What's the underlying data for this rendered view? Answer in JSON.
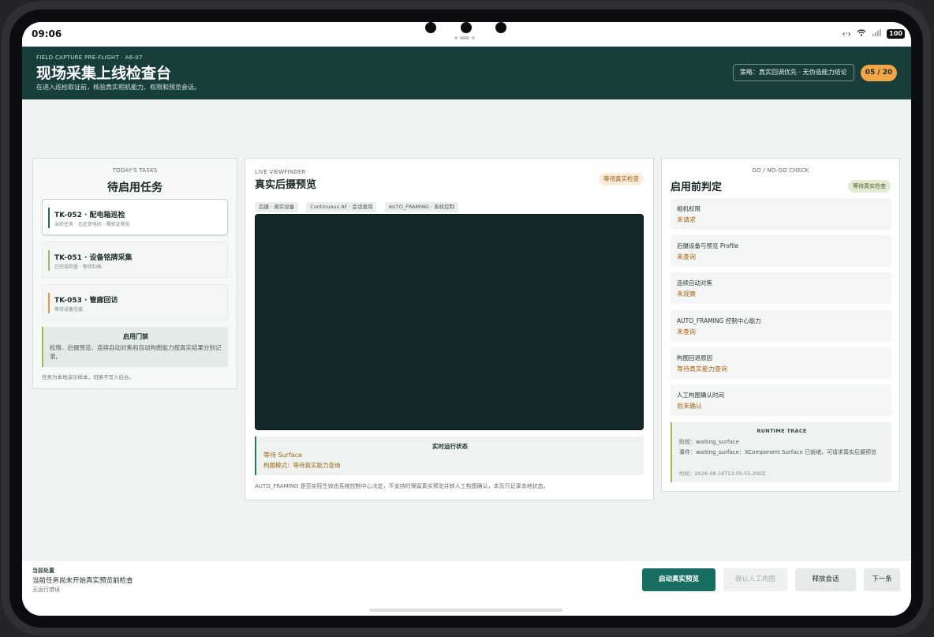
{
  "status_bar": {
    "time": "09:06",
    "battery": "100"
  },
  "header": {
    "eyebrow": "FIELD CAPTURE PRE-FLIGHT · A6-07",
    "title": "现场采集上线检查台",
    "subtitle": "在进入巡检取证前，核验真实相机能力、权限和预览会话。",
    "strategy": "策略：真实回调优先 · 无伪造能力结论",
    "counter": "05 / 20"
  },
  "tasks_panel": {
    "eyebrow": "TODAY'S TASKS",
    "title": "待启用任务",
    "tasks": [
      {
        "title": "TK-052 · 配电箱巡检",
        "subtitle": "当前任务 · 北区变电间 · 需验证预览",
        "accent": "#1e6f63"
      },
      {
        "title": "TK-051 · 设备铭牌采集",
        "subtitle": "已完成检查 · 等待归档",
        "accent": "#9bbb55"
      },
      {
        "title": "TK-053 · 管廊回访",
        "subtitle": "等待设备交接",
        "accent": "#e79b3f"
      }
    ],
    "gate": {
      "title": "启用门禁",
      "text": "权限、后摄预览、连续自动对焦和自动构图能力按真实结果分别记录。"
    },
    "note": "任务为本地演示样本，切换不写入后台。"
  },
  "viewfinder_panel": {
    "eyebrow": "LIVE VIEWFINDER",
    "title": "真实后摄预览",
    "status_pill": "等待真实检查",
    "tags": [
      "后摄 · 真实设备",
      "Continuous AF · 会话查询",
      "AUTO_FRAMING · 系统控制"
    ],
    "runtime": {
      "title": "实时运行状态",
      "status": "等待 Surface",
      "mode_label": "构图模式：",
      "mode_value": "等待真实能力查询"
    },
    "footnote": "AUTO_FRAMING 是否实际生效由系统控制中心决定，不支持时保留真实预览并转人工构图确认，本页只记录本地状态。"
  },
  "check_panel": {
    "eyebrow": "GO / NO-GO CHECK",
    "title": "启用前判定",
    "status_pill": "等待真实检查",
    "checks": [
      {
        "label": "相机权限",
        "value": "未请求"
      },
      {
        "label": "后摄设备与预览 Profile",
        "value": "未查询"
      },
      {
        "label": "连续自动对焦",
        "value": "未观察"
      },
      {
        "label": "AUTO_FRAMING 控制中心能力",
        "value": "未查询"
      },
      {
        "label": "构图回退原因",
        "value": "等待真实能力查询"
      },
      {
        "label": "人工构图确认时间",
        "value": "尚未确认"
      }
    ],
    "trace": {
      "title": "RUNTIME TRACE",
      "stage": "阶段：waiting_surface",
      "event": "事件：waiting_surface：XComponent Surface 已就绪，可请求真实后摄预览",
      "time": "时间：2026-08-16T13:05:55.200Z"
    }
  },
  "footer": {
    "label": "当前处置",
    "status": "当前任务尚未开始真实预览前检查",
    "error": "无运行错误",
    "buttons": {
      "start": "启动真实预览",
      "confirm": "确认人工构图",
      "release": "释放会话",
      "next": "下一条"
    }
  }
}
